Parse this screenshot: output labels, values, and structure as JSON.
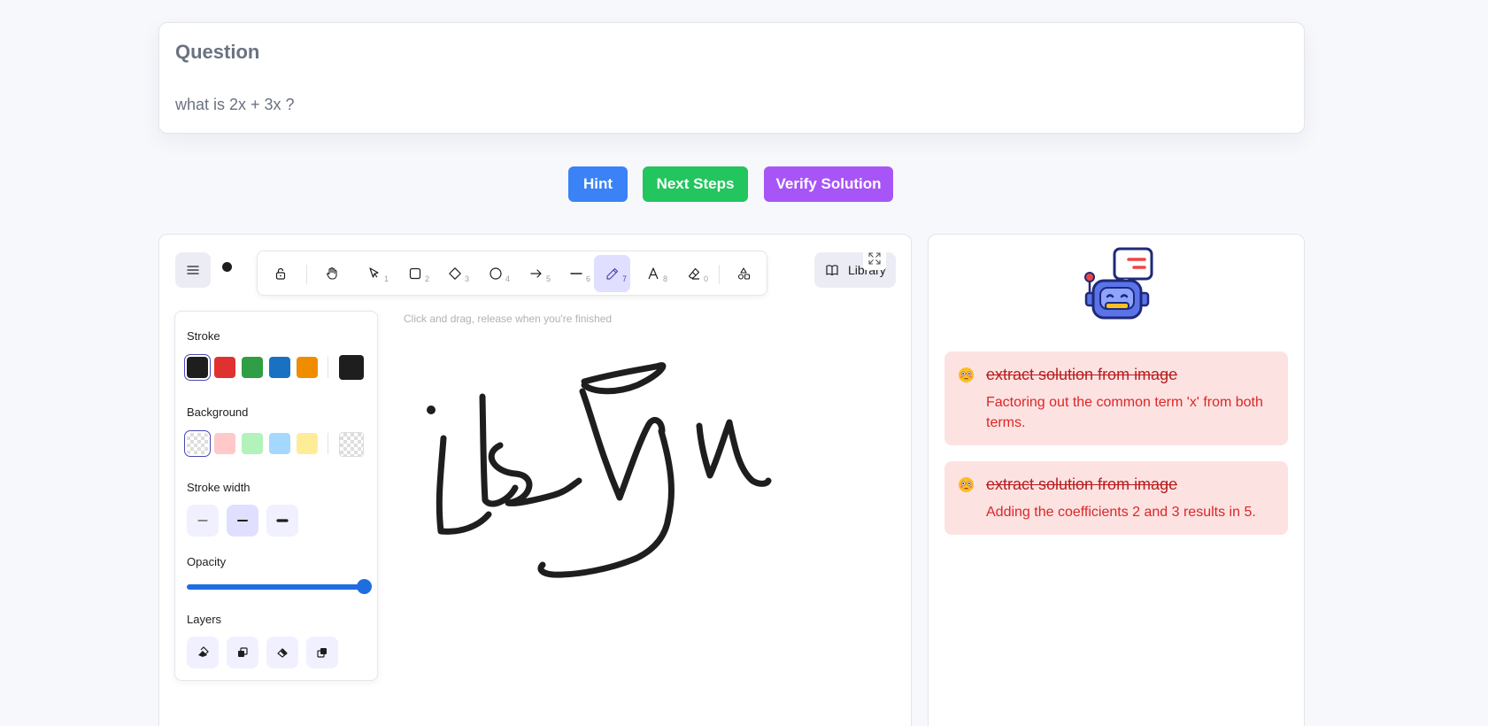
{
  "question": {
    "title": "Question",
    "text": "what is 2x + 3x ?"
  },
  "actions": {
    "hint": "Hint",
    "next_steps": "Next Steps",
    "verify": "Verify Solution"
  },
  "colors": {
    "hint": "#3b82f6",
    "next_steps": "#22c55e",
    "verify": "#a855f7",
    "feedback_bg": "#fde2e2",
    "feedback_text": "#dc2626"
  },
  "toolbar": {
    "tools": [
      {
        "name": "lock",
        "icon": "lock-open-icon",
        "key": ""
      },
      {
        "name": "hand",
        "icon": "hand-icon",
        "key": ""
      },
      {
        "name": "selection",
        "icon": "pointer-icon",
        "key": "1"
      },
      {
        "name": "rectangle",
        "icon": "square-icon",
        "key": "2"
      },
      {
        "name": "diamond",
        "icon": "diamond-icon",
        "key": "3"
      },
      {
        "name": "ellipse",
        "icon": "circle-icon",
        "key": "4"
      },
      {
        "name": "arrow",
        "icon": "arrow-right-icon",
        "key": "5"
      },
      {
        "name": "line",
        "icon": "line-icon",
        "key": "6"
      },
      {
        "name": "draw",
        "icon": "pencil-icon",
        "key": "7",
        "active": true
      },
      {
        "name": "text",
        "icon": "text-icon",
        "key": "8"
      },
      {
        "name": "eraser",
        "icon": "eraser-icon",
        "key": "0"
      },
      {
        "name": "shapes",
        "icon": "shapes-icon",
        "key": ""
      }
    ],
    "library_label": "Library"
  },
  "canvas": {
    "hint": "Click and drag, release when you're finished"
  },
  "properties": {
    "stroke_label": "Stroke",
    "stroke_colors": [
      "#1e1e1e",
      "#e03131",
      "#2f9e44",
      "#1971c2",
      "#f08c00"
    ],
    "stroke_current": "#1e1e1e",
    "background_label": "Background",
    "background_colors": [
      "transparent",
      "#ffc9c9",
      "#b2f2bb",
      "#a5d8ff",
      "#ffec99"
    ],
    "stroke_width_label": "Stroke width",
    "opacity_label": "Opacity",
    "opacity_value": 100,
    "layers_label": "Layers"
  },
  "feedback": [
    {
      "emoji": "flushed-face",
      "title": "extract solution from image",
      "description": "Factoring out the common term 'x' from both terms."
    },
    {
      "emoji": "flushed-face",
      "title": "extract solution from image",
      "description": "Adding the coefficients 2 and 3 results in 5."
    }
  ]
}
